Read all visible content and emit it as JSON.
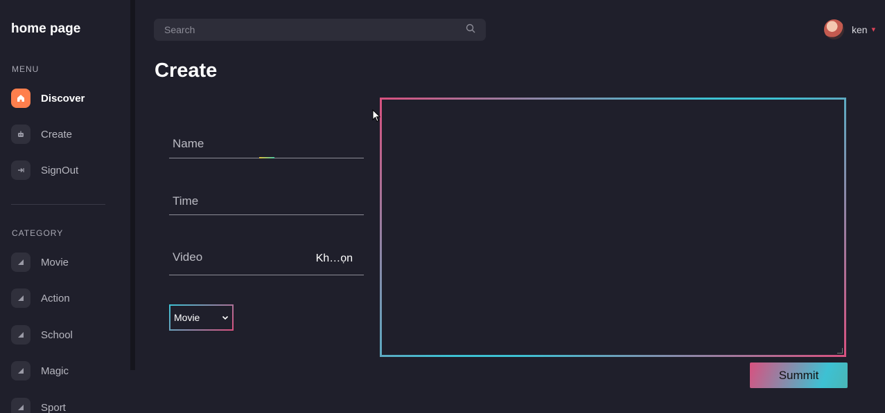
{
  "sidebar": {
    "logo": "home page",
    "menu_label": "MENU",
    "menu_items": [
      {
        "label": "Discover",
        "icon": "home-icon",
        "active": true
      },
      {
        "label": "Create",
        "icon": "robot-icon",
        "active": false
      },
      {
        "label": "SignOut",
        "icon": "signout-icon",
        "active": false
      }
    ],
    "category_label": "CATEGORY",
    "categories": [
      {
        "label": "Movie",
        "icon": "triangle-icon"
      },
      {
        "label": "Action",
        "icon": "triangle-icon"
      },
      {
        "label": "School",
        "icon": "triangle-icon"
      },
      {
        "label": "Magic",
        "icon": "triangle-icon"
      },
      {
        "label": "Sport",
        "icon": "triangle-icon"
      }
    ]
  },
  "header": {
    "search_placeholder": "Search",
    "user_name": "ken"
  },
  "main": {
    "title": "Create",
    "form": {
      "name_label": "Name",
      "time_label": "Time",
      "video_label": "Video",
      "video_file": "Kh…ọn",
      "category_select": "Movie",
      "submit_label": "Summit"
    }
  },
  "colors": {
    "background": "#1f1f2b",
    "accent_orange": "#ff7f4d",
    "gradient_pink": "#d8517f",
    "gradient_teal": "#3dc1d3"
  }
}
